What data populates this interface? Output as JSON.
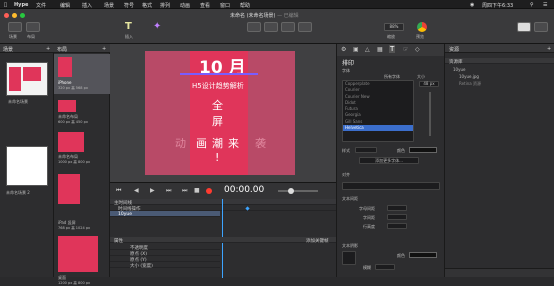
{
  "menubar": {
    "app": "Hype",
    "items": [
      "文件",
      "编辑",
      "插入",
      "场景",
      "符号",
      "格式",
      "排列",
      "动画",
      "查看",
      "窗口",
      "帮助"
    ],
    "clock": "周四下午6:33"
  },
  "window": {
    "title": "未命名 (未命名场景)",
    "title_suffix": "— 已编辑",
    "toolbar": {
      "scene": "场景",
      "layout": "布局",
      "zoom": "88%",
      "insert_label": "插入",
      "zoom_label": "缩放",
      "preview_label": "预览",
      "inspector_label": "检查器"
    }
  },
  "scenes": {
    "title": "场景",
    "layout": "布局",
    "items": [
      {
        "label": "未命名场景"
      },
      {
        "label": "未命名场景 2"
      }
    ]
  },
  "layouts": {
    "title": "布局",
    "items": [
      {
        "name": "iPhone",
        "size": "320 px 高 568 px"
      },
      {
        "name": "未命名布局",
        "size": "600 px 高 450 px"
      },
      {
        "name": "未命名布局",
        "size": "1000 px 高 800 px"
      },
      {
        "name": "iPad 竖屏",
        "size": "768 px 高 1024 px"
      },
      {
        "name": "桌面",
        "size": "1200 px 高 800 px"
      }
    ]
  },
  "canvas": {
    "line1": "10 月",
    "line2": "H5设计趋势解析",
    "line3": "全",
    "line4": "屏",
    "line5": "动",
    "line6": "画",
    "line7": "潮",
    "line8": "来",
    "line9": "袭",
    "line10": "!"
  },
  "timeline": {
    "time": "00:00.00",
    "main_timeline": "主时间线",
    "tracks": [
      "时间线操作",
      "10yue"
    ],
    "properties": "属性",
    "add_property": "添加关键帧",
    "props": [
      "不透明度",
      "原点 (X)",
      "原点 (Y)",
      "大小 (宽度)"
    ]
  },
  "inspector": {
    "section": "排印",
    "font_label": "字体",
    "font_size_label": "所有字体",
    "fonts": [
      "Copperplate",
      "Courier",
      "Courier New",
      "Didot",
      "Futura",
      "Georgia",
      "Gill Sans",
      "Helvetica"
    ],
    "size_label": "大小",
    "size_value": "48 px",
    "style_label": "样式",
    "color_label": "颜色",
    "add_more_fonts": "添加更多字体...",
    "align_label": "对齐",
    "layout_label": "文本间距",
    "letter_spacing": "字母间距",
    "word_spacing": "字间距",
    "line_height": "行高度",
    "text_shadow": "文本阴影",
    "shadow_color": "颜色",
    "shadow_blur": "模糊"
  },
  "resources": {
    "title": "资源",
    "library": "资源库",
    "items": [
      "10yue",
      "10yue.jpg",
      "Retina 资源"
    ]
  },
  "colors": {
    "menubar": "#1e1e1f",
    "canvas": "#b84a67",
    "card": "#e0355a",
    "accent": "#3da4ff",
    "record": "#ff3b30"
  }
}
